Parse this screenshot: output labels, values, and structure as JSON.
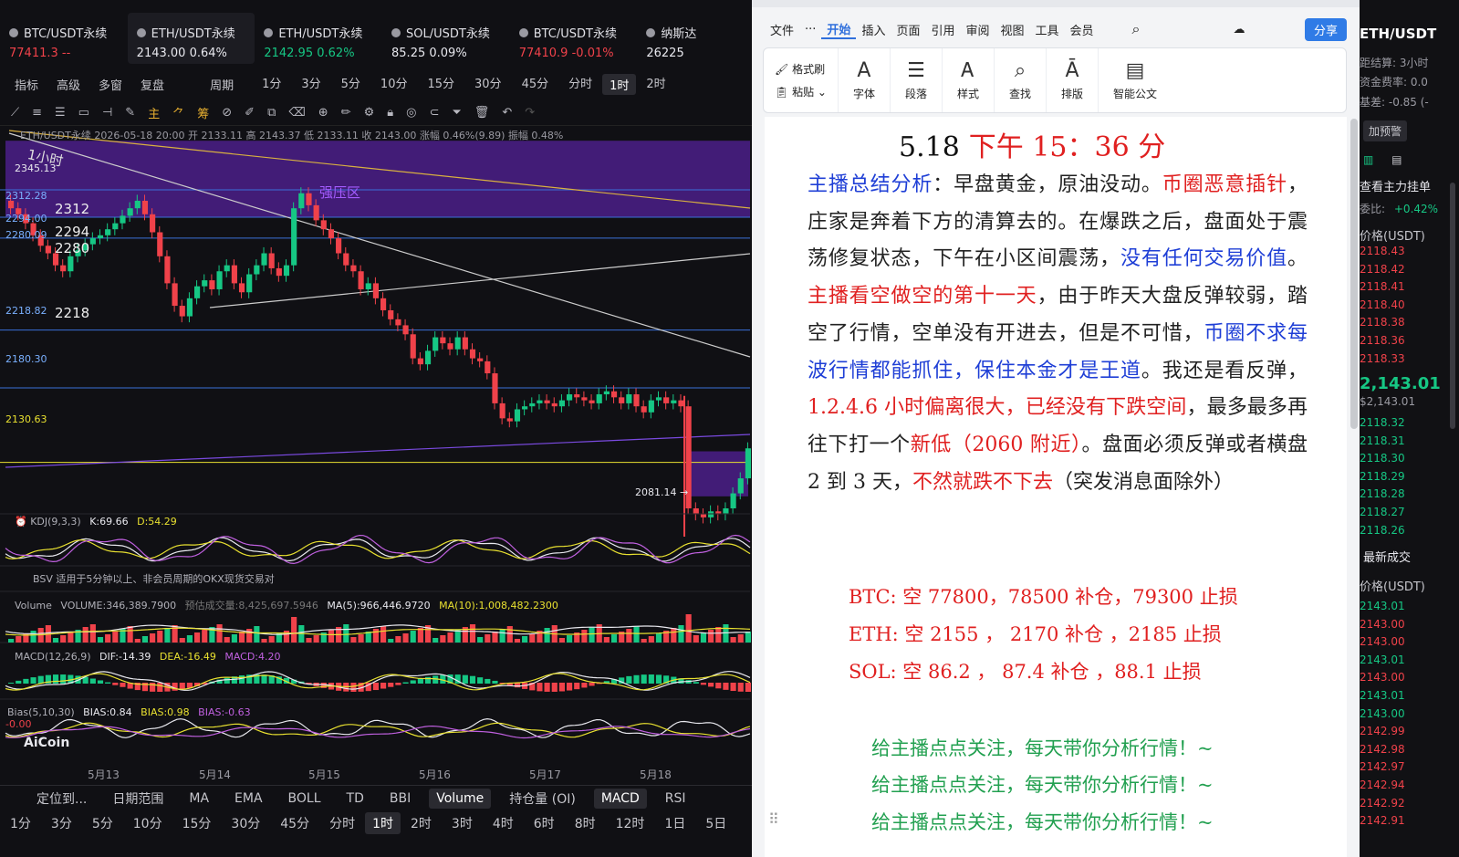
{
  "tickers": [
    {
      "name": "BTC/USDT永续",
      "price": "77411.3",
      "change": "--",
      "color": "#f0424a",
      "active": false
    },
    {
      "name": "ETH/USDT永续",
      "price": "2143.00",
      "change": "0.64%",
      "color": "#e8e8ee",
      "active": true
    },
    {
      "name": "ETH/USDT永续",
      "price": "2142.95",
      "change": "0.62%",
      "color": "#16c784",
      "active": false
    },
    {
      "name": "SOL/USDT永续",
      "price": "85.25",
      "change": "0.09%",
      "color": "#e8e8ee",
      "active": false
    },
    {
      "name": "BTC/USDT永续",
      "price": "77410.9",
      "change": "-0.01%",
      "color": "#f0424a",
      "active": false
    },
    {
      "name": "纳斯达",
      "price": "26225",
      "change": "",
      "color": "#e8e8ee",
      "active": false
    }
  ],
  "menu": {
    "items": [
      "指标",
      "高级",
      "多窗",
      "复盘",
      "周期"
    ],
    "periods": [
      "1分",
      "3分",
      "5分",
      "10分",
      "15分",
      "30分",
      "45分",
      "分时",
      "1时",
      "2时"
    ],
    "selected": "1时"
  },
  "chart": {
    "info": "ETH/USDT永续  2026-05-18 20:00  开 2133.11  高 2143.37  低 2133.11  收 2143.00  涨幅 0.46%(9.89)  振幅 0.48%",
    "timeframe_note": "1小时",
    "zone_label": "强压区",
    "levels": [
      "2312.28",
      "2294.00",
      "2280.09",
      "2218.82",
      "2180.30",
      "2130.63"
    ],
    "level_tags": [
      "2312",
      "2294",
      "2280",
      "2218"
    ],
    "high_label": "2345.13",
    "low_label": "2081.14 →",
    "kdj": {
      "name": "KDJ(9,3,3)",
      "k": "K:69.66",
      "d": "D:54.29"
    },
    "bsv": "BSV   适用于5分钟以上、非会员周期的OKX现货交易对",
    "volume": {
      "name": "Volume",
      "v": "VOLUME:346,389.7900",
      "est": "预估成交量:8,425,697.5946",
      "ma5": "MA(5):966,446.9720",
      "ma10": "MA(10):1,008,482.2300"
    },
    "macd": {
      "name": "MACD(12,26,9)",
      "dif": "DIF:-14.39",
      "dea": "DEA:-16.49",
      "macd": "MACD:4.20"
    },
    "bias": {
      "name": "Bias(5,10,30)",
      "b1": "BIAS:0.84",
      "b2": "BIAS:0.98",
      "b3": "BIAS:-0.63",
      "zero": "-0.00"
    },
    "logo": "AiCoin",
    "dates": [
      "5月13",
      "5月14",
      "5月15",
      "5月16",
      "5月17",
      "5月18"
    ]
  },
  "indicator_bar": [
    "定位到...",
    "日期范围",
    "MA",
    "EMA",
    "BOLL",
    "TD",
    "BBI",
    "Volume",
    "持仓量 (OI)",
    "MACD",
    "RSI"
  ],
  "period_bar": [
    "1分",
    "3分",
    "5分",
    "10分",
    "15分",
    "30分",
    "45分",
    "分时",
    "1时",
    "2时",
    "3时",
    "4时",
    "6时",
    "8时",
    "12时",
    "1日",
    "5日"
  ],
  "doc": {
    "menu": [
      "文件",
      "开始",
      "插入",
      "页面",
      "引用",
      "审阅",
      "视图",
      "工具",
      "会员"
    ],
    "share": "分享",
    "ribbon": [
      "格式刷",
      "粘贴",
      "字体",
      "段落",
      "样式",
      "查找",
      "排版",
      "智能公文"
    ],
    "title_date": "5.18",
    "title_time": "下午 15：36 分",
    "body": [
      {
        "t": "主播总结分析",
        "c": "blue"
      },
      {
        "t": "：早盘黄金，原油没动。",
        "c": "dark"
      },
      {
        "t": "币圈恶意插针",
        "c": "red"
      },
      {
        "t": "，庄家是奔着下方的清算去的。在爆跌之后，盘面处于震荡修复状态，下午在小区间震荡，",
        "c": "dark"
      },
      {
        "t": "没有任何交易价值",
        "c": "blue"
      },
      {
        "t": "。",
        "c": "dark"
      },
      {
        "t": "主播看空做空的第十一天",
        "c": "red"
      },
      {
        "t": "，由于昨天大盘反弹较弱，踏空了行情，空单没有开进去，但是不可惜，",
        "c": "dark"
      },
      {
        "t": "币圈不求每波行情都能抓住，保住本金才是王道",
        "c": "blue"
      },
      {
        "t": "。我还是看反弹，",
        "c": "dark"
      },
      {
        "t": "1.2.4.6 小时偏离很大，已经没有下跌空间",
        "c": "red"
      },
      {
        "t": "，最多最多再往下打一个",
        "c": "dark"
      },
      {
        "t": "新低（2060 附近）",
        "c": "red"
      },
      {
        "t": "。盘面必须反弹或者横盘 2 到 3 天，",
        "c": "dark"
      },
      {
        "t": "不然就跌不下去",
        "c": "red"
      },
      {
        "t": "（突发消息面除外）",
        "c": "dark"
      }
    ],
    "calls": [
      "BTC:  空 77800，78500 补仓，79300 止损",
      "ETH:  空 2155  ，  2170 补仓  ，2185 止损",
      "SOL:  空 86.2  ，  87.4 补仓  ，88.1 止损"
    ],
    "follow": [
      "给主播点点关注，每天带你分析行情！~",
      "给主播点点关注，每天带你分析行情！~",
      "给主播点点关注，每天带你分析行情！~"
    ]
  },
  "right_panel": {
    "symbol": "ETH/USDT",
    "settle": "距结算:  3小时",
    "fee": "资金费率:  0.0",
    "basis": "基差:  -0.85 (-",
    "add_alert": "加预警",
    "section": "查看主力挂单",
    "ratio_label": "委比:",
    "ratio_val": "+0.42%",
    "price_header": "价格(USDT)",
    "asks": [
      "2118.43",
      "2118.42",
      "2118.41",
      "2118.40",
      "2118.38",
      "2118.36",
      "2118.33"
    ],
    "last": "2,143.01",
    "last_sub": "$2,143.01",
    "bids": [
      "2118.32",
      "2118.31",
      "2118.30",
      "2118.29",
      "2118.28",
      "2118.27",
      "2118.26"
    ],
    "trades_title": "最新成交",
    "trades": [
      {
        "p": "2143.01",
        "c": "#16c784"
      },
      {
        "p": "2143.00",
        "c": "#f0424a"
      },
      {
        "p": "2143.00",
        "c": "#f0424a"
      },
      {
        "p": "2143.01",
        "c": "#16c784"
      },
      {
        "p": "2143.00",
        "c": "#f0424a"
      },
      {
        "p": "2143.01",
        "c": "#16c784"
      },
      {
        "p": "2143.00",
        "c": "#16c784"
      },
      {
        "p": "2142.99",
        "c": "#f0424a"
      },
      {
        "p": "2142.98",
        "c": "#f0424a"
      },
      {
        "p": "2142.97",
        "c": "#f0424a"
      },
      {
        "p": "2142.94",
        "c": "#f0424a"
      },
      {
        "p": "2142.92",
        "c": "#f0424a"
      },
      {
        "p": "2142.91",
        "c": "#f0424a"
      }
    ]
  },
  "colors": {
    "up": "#16c784",
    "down": "#f0424a",
    "accent": "#2f7be6",
    "zone": "#4b1e88"
  }
}
